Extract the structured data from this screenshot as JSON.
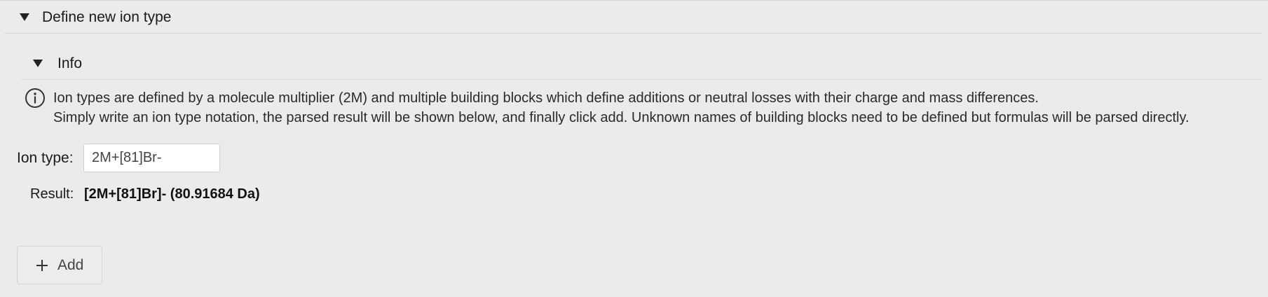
{
  "section": {
    "title": "Define new ion type"
  },
  "info": {
    "title": "Info",
    "icon": "info-icon",
    "lines": [
      "Ion types are defined by a molecule multiplier (2M) and multiple building blocks which define additions or neutral losses with their charge and mass differences.",
      "Simply write an ion type notation, the parsed result will be shown below, and finally click add. Unknown names of building blocks need to be defined but formulas will be parsed directly."
    ]
  },
  "ion_type": {
    "label": "Ion type:",
    "value": "2M+[81]Br-"
  },
  "result": {
    "label": "Result:",
    "value": "[2M+[81]Br]- (80.91684 Da)"
  },
  "add_button": {
    "icon": "plus-icon",
    "label": "Add"
  }
}
